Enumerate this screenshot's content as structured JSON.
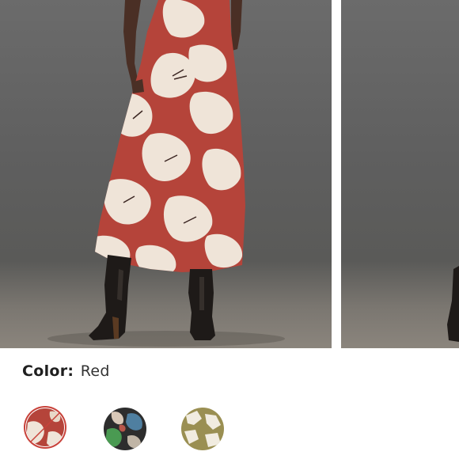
{
  "product": {
    "color_label": "Color:",
    "color_value": "Red"
  },
  "swatches": [
    {
      "name": "red-floral",
      "selected": true,
      "color": "#c8423a"
    },
    {
      "name": "dark-floral",
      "selected": false,
      "color": "#2d2d2d"
    },
    {
      "name": "olive-print",
      "selected": false,
      "color": "#9a8f52"
    }
  ],
  "colors": {
    "background": "#ffffff",
    "dress_red": "#b5443a",
    "dress_cream": "#efe4d8",
    "photo_bg": "#636363"
  }
}
